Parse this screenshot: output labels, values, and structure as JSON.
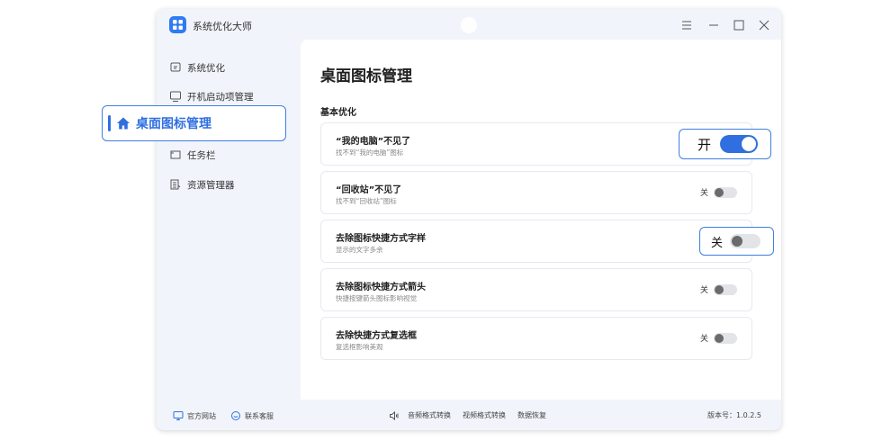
{
  "app": {
    "title": "系统优化大师"
  },
  "sidebar": {
    "items": [
      {
        "label": "系统优化",
        "icon": "system-optimize-icon"
      },
      {
        "label": "开机启动项管理",
        "icon": "monitor-icon"
      },
      {
        "label": "桌面图标管理",
        "icon": "home-icon",
        "active": true
      },
      {
        "label": "任务栏",
        "icon": "taskbar-icon"
      },
      {
        "label": "资源管理器",
        "icon": "file-manager-icon"
      }
    ]
  },
  "main": {
    "title": "桌面图标管理",
    "section": "基本优化",
    "cards": [
      {
        "title": "“我的电脑”不见了",
        "desc": "找不到“我的电脑”图标",
        "state": "开",
        "on": true
      },
      {
        "title": "“回收站”不见了",
        "desc": "找不到“回收站”图标",
        "state": "关",
        "on": false
      },
      {
        "title": "去除图标快捷方式字样",
        "desc": "显示的文字多余",
        "state": "关",
        "on": false
      },
      {
        "title": "去除图标快捷方式箭头",
        "desc": "快捷按键箭头图标影响视觉",
        "state": "关",
        "on": false
      },
      {
        "title": "去除快捷方式复选框",
        "desc": "复选框影响美观",
        "state": "关",
        "on": false
      }
    ]
  },
  "footer": {
    "website": "官方网站",
    "support": "联系客服",
    "audio_convert": "音频格式转换",
    "video_convert": "视频格式转换",
    "data_recovery": "数据恢复",
    "version": "版本号：1.0.2.5"
  },
  "callouts": {
    "nav_label": "桌面图标管理",
    "on_label": "开",
    "off_label": "关"
  },
  "colors": {
    "accent": "#2f6fe0",
    "background": "#f1f5fb"
  }
}
